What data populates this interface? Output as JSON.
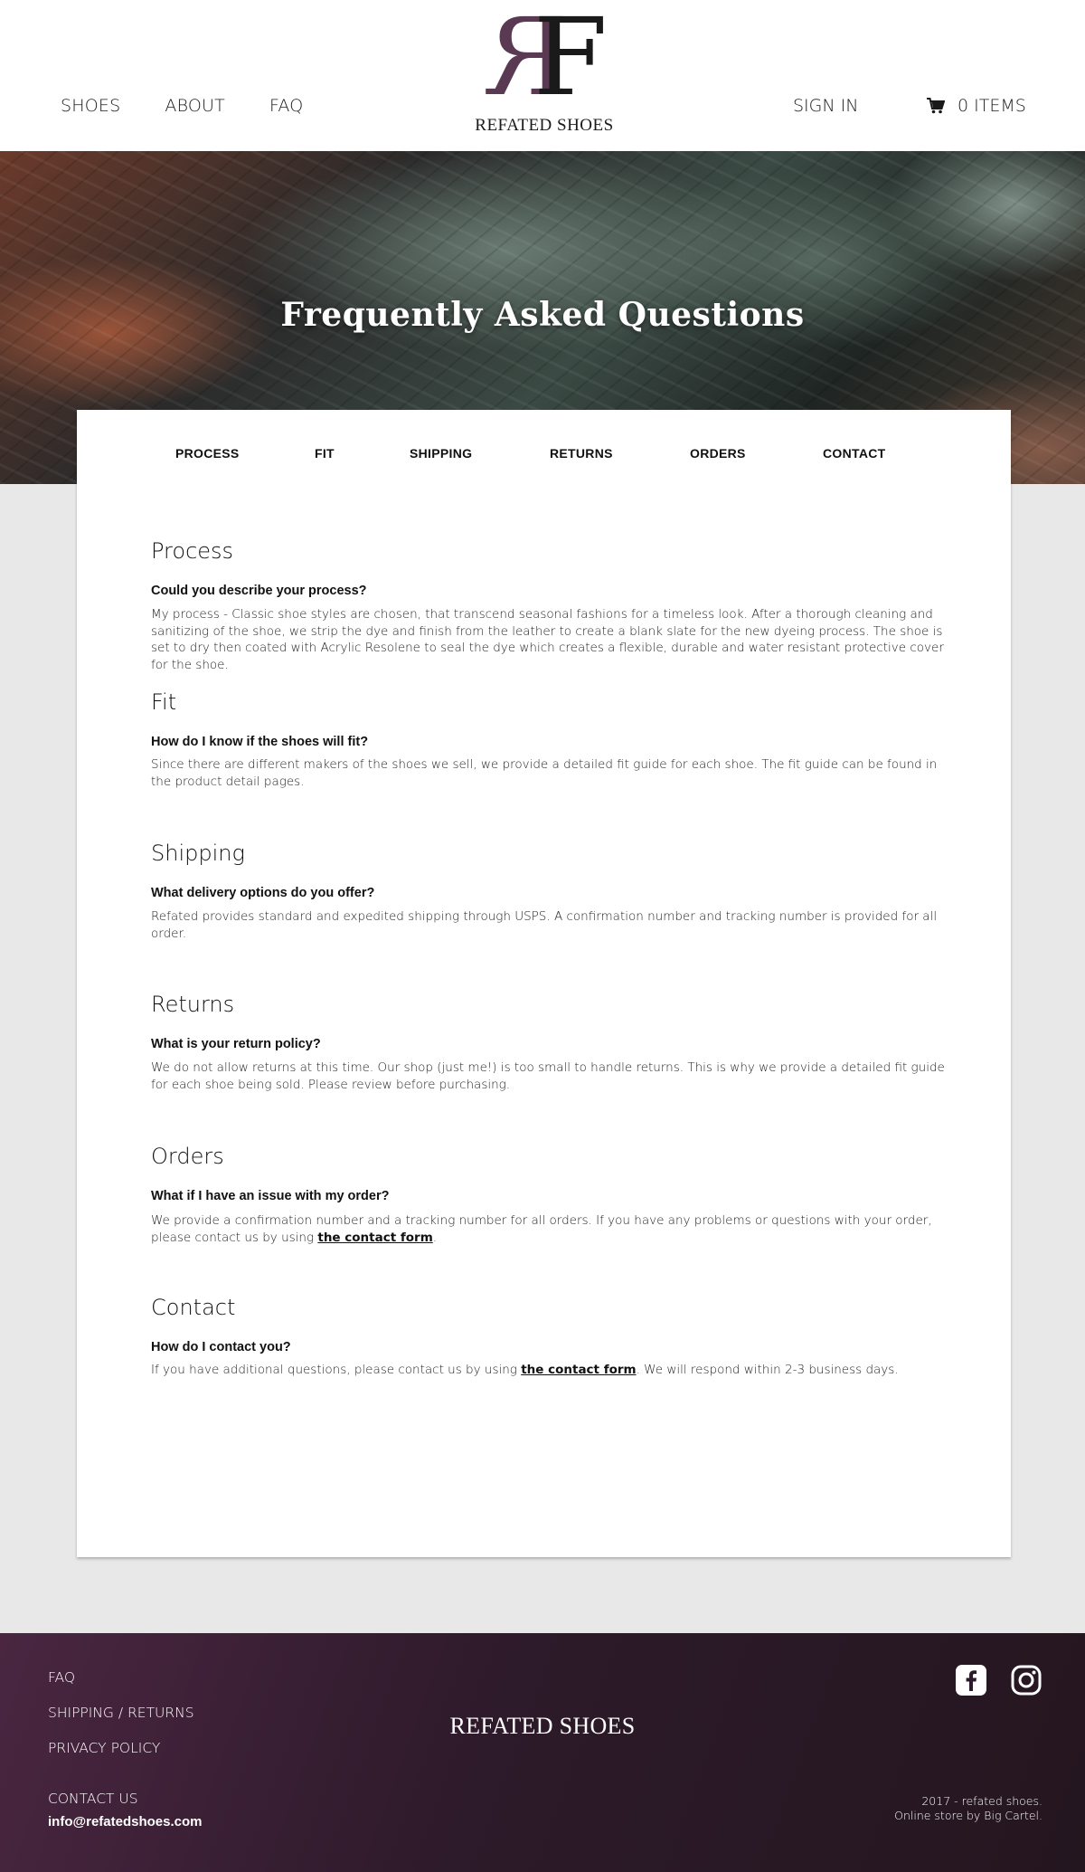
{
  "header": {
    "nav": [
      {
        "label": "SHOES"
      },
      {
        "label": "ABOUT"
      },
      {
        "label": "FAQ"
      }
    ],
    "logo_letters": [
      "R",
      "F"
    ],
    "logo_text": "REFATED SHOES",
    "sign_in": "SIGN IN",
    "cart_label": "0 ITEMS",
    "cart_icon": "cart-icon"
  },
  "hero": {
    "title": "Frequently Asked Questions"
  },
  "tabs": [
    {
      "label": "PROCESS"
    },
    {
      "label": "FIT"
    },
    {
      "label": "SHIPPING"
    },
    {
      "label": "RETURNS"
    },
    {
      "label": "ORDERS"
    },
    {
      "label": "CONTACT"
    }
  ],
  "sections": [
    {
      "title": "Process",
      "question": "Could you describe your process?",
      "answer": "My process - Classic shoe styles are chosen, that transcend seasonal fashions for a timeless look. After a thorough cleaning and sanitizing of the shoe, we strip the dye and finish from the leather to create a blank slate for the new dyeing process. The shoe is set to dry then coated with Acrylic Resolene to seal the dye which creates a flexible, durable and water resistant protective cover for the shoe."
    },
    {
      "title": "Fit",
      "question": "How do I know if the shoes will fit?",
      "answer": "Since there are different makers of the shoes we sell, we provide a detailed fit guide for each shoe. The fit guide can be found in the product detail pages."
    },
    {
      "title": "Shipping",
      "question": "What delivery options do you offer?",
      "answer": "Refated provides standard and expedited shipping through USPS. A confirmation number  and tracking number is provided for all order."
    },
    {
      "title": "Returns",
      "question": "What is your return policy?",
      "answer": "We do not allow returns at this time. Our shop (just me!) is too small to handle returns. This is why we provide a detailed fit guide for each shoe being sold. Please review before purchasing."
    },
    {
      "title": "Orders",
      "question": "What if I have an issue with my order?",
      "answer_before": "We provide a confirmation number and a tracking number for all orders. If you have any problems or questions with your order, please contact us by using ",
      "link": "the contact form",
      "answer_after": "."
    },
    {
      "title": "Contact",
      "question": "How do I contact you?",
      "answer_before": "If you have additional questions, please contact us by using ",
      "link": "the contact form",
      "answer_after": ". We will respond within 2-3 business days."
    }
  ],
  "footer": {
    "links": [
      "FAQ",
      "SHIPPING / RETURNS",
      "PRIVACY POLICY"
    ],
    "contact_label": "CONTACT US",
    "email": "info@refatedshoes.com",
    "brand": "REFATED SHOES",
    "copyright_line1": "2017 - refated shoes.",
    "copyright_line2": "Online store by Big Cartel.",
    "social_icons": [
      "facebook-icon",
      "instagram-icon"
    ]
  },
  "colors": {
    "footer_start": "#4a2641",
    "footer_end": "#24161f",
    "logo_accent": "#5a3a52",
    "page_bg": "#e8e8e8"
  }
}
